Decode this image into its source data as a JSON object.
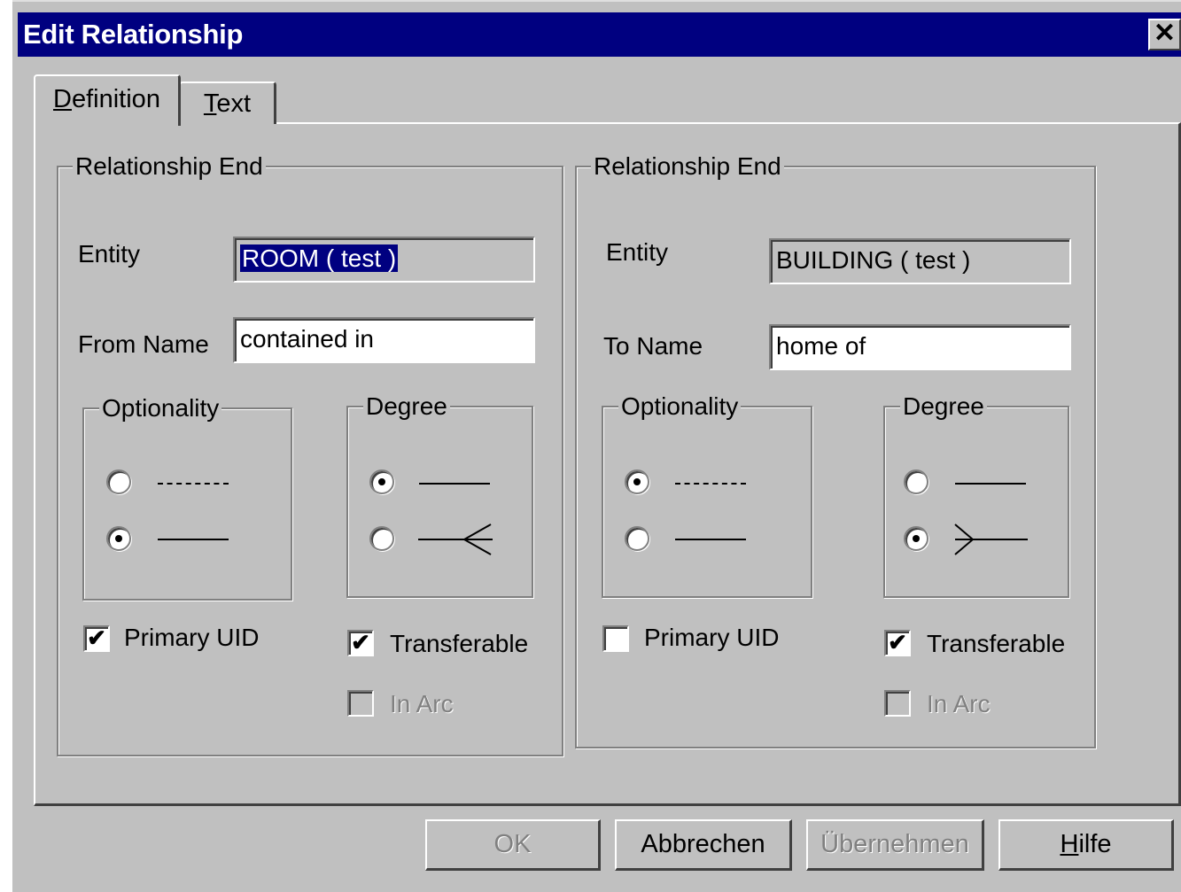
{
  "window": {
    "title": "Edit Relationship",
    "close_glyph": "✕"
  },
  "tabs": [
    {
      "label": "Definition",
      "mnemonic": "D",
      "rest": "efinition",
      "selected": true
    },
    {
      "label": "Text",
      "mnemonic": "T",
      "rest": "ext",
      "selected": false
    }
  ],
  "left_end": {
    "group_title": "Relationship End",
    "entity_label": "Entity",
    "entity_value": "ROOM   ( test )",
    "name_label": "From Name",
    "name_value": "contained in",
    "optionality": {
      "title": "Optionality",
      "selected": "mandatory"
    },
    "degree": {
      "title": "Degree",
      "selected": "one"
    },
    "primary_uid": {
      "label": "Primary UID",
      "checked": true
    },
    "transferable": {
      "label": "Transferable",
      "checked": true
    },
    "in_arc": {
      "label": "In Arc",
      "checked": false,
      "enabled": false
    }
  },
  "right_end": {
    "group_title": "Relationship End",
    "entity_label": "Entity",
    "entity_value": "BUILDING   ( test )",
    "name_label": "To Name",
    "name_value": "home of",
    "optionality": {
      "title": "Optionality",
      "selected": "optional"
    },
    "degree": {
      "title": "Degree",
      "selected": "many"
    },
    "primary_uid": {
      "label": "Primary UID",
      "checked": false
    },
    "transferable": {
      "label": "Transferable",
      "checked": true
    },
    "in_arc": {
      "label": "In Arc",
      "checked": false,
      "enabled": false
    }
  },
  "buttons": {
    "ok": {
      "label": "OK",
      "enabled": false
    },
    "cancel": {
      "label": "Abbrechen",
      "enabled": true
    },
    "apply": {
      "label": "Übernehmen",
      "enabled": false
    },
    "help": {
      "label": "Hilfe",
      "mnemonic": "H",
      "rest": "ilfe",
      "enabled": true
    }
  },
  "colors": {
    "face": "#c0c0c0",
    "title_bar": "#000080",
    "selection": "#000080",
    "disabled_text": "#808080"
  },
  "check_glyph": "✔"
}
